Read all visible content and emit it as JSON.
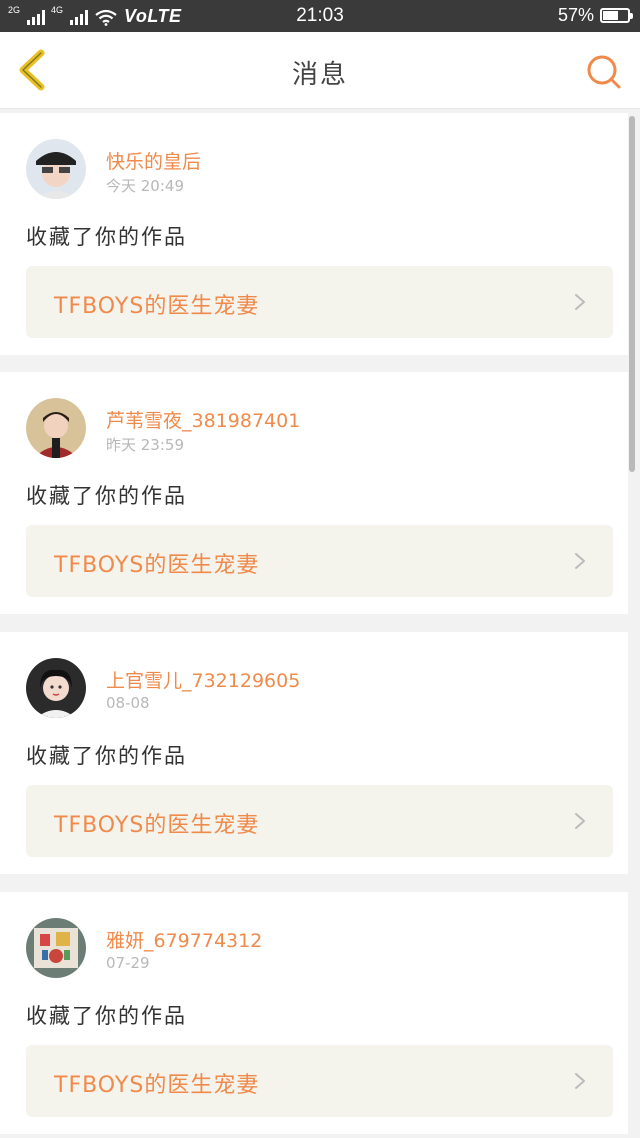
{
  "status_bar": {
    "network_1": "2G",
    "network_2": "4G",
    "carrier": "VoLTE",
    "time": "21:03",
    "battery_percent": "57%",
    "battery_level": 0.57
  },
  "header": {
    "title": "消息",
    "back_icon": "chevron-left-icon",
    "search_icon": "search-icon"
  },
  "colors": {
    "accent": "#f08a4b",
    "back_icon": "#e8c020",
    "work_card_bg": "#f4f3ec"
  },
  "messages": [
    {
      "username": "快乐的皇后",
      "time": "今天 20:49",
      "action": "收藏了你的作品",
      "work_title": "TFBOYS的医生宠妻"
    },
    {
      "username": "芦苇雪夜_381987401",
      "time": "昨天 23:59",
      "action": "收藏了你的作品",
      "work_title": "TFBOYS的医生宠妻"
    },
    {
      "username": "上官雪儿_732129605",
      "time": "08-08",
      "action": "收藏了你的作品",
      "work_title": "TFBOYS的医生宠妻"
    },
    {
      "username": "雅妍_679774312",
      "time": "07-29",
      "action": "收藏了你的作品",
      "work_title": "TFBOYS的医生宠妻"
    }
  ]
}
